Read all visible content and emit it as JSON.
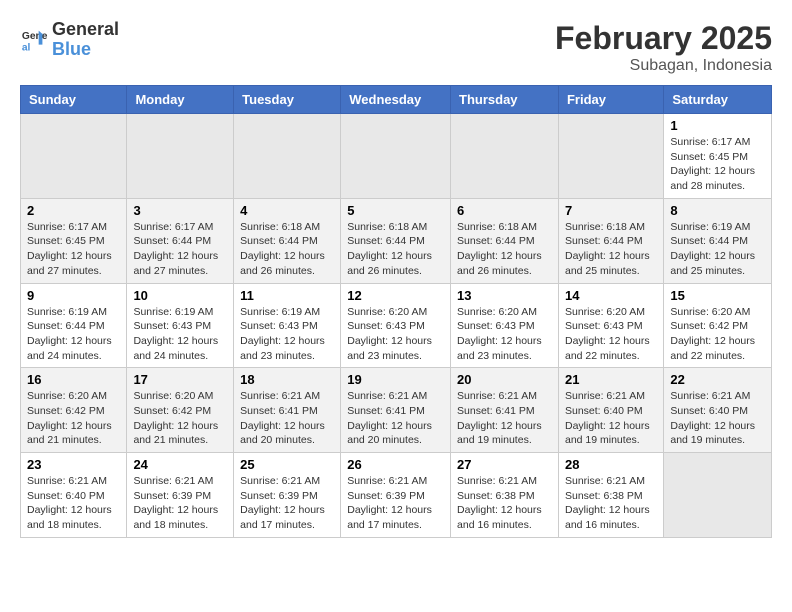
{
  "header": {
    "logo_general": "General",
    "logo_blue": "Blue",
    "month_title": "February 2025",
    "location": "Subagan, Indonesia"
  },
  "weekdays": [
    "Sunday",
    "Monday",
    "Tuesday",
    "Wednesday",
    "Thursday",
    "Friday",
    "Saturday"
  ],
  "weeks": [
    [
      {
        "day": "",
        "info": ""
      },
      {
        "day": "",
        "info": ""
      },
      {
        "day": "",
        "info": ""
      },
      {
        "day": "",
        "info": ""
      },
      {
        "day": "",
        "info": ""
      },
      {
        "day": "",
        "info": ""
      },
      {
        "day": "1",
        "info": "Sunrise: 6:17 AM\nSunset: 6:45 PM\nDaylight: 12 hours and 28 minutes."
      }
    ],
    [
      {
        "day": "2",
        "info": "Sunrise: 6:17 AM\nSunset: 6:45 PM\nDaylight: 12 hours and 27 minutes."
      },
      {
        "day": "3",
        "info": "Sunrise: 6:17 AM\nSunset: 6:44 PM\nDaylight: 12 hours and 27 minutes."
      },
      {
        "day": "4",
        "info": "Sunrise: 6:18 AM\nSunset: 6:44 PM\nDaylight: 12 hours and 26 minutes."
      },
      {
        "day": "5",
        "info": "Sunrise: 6:18 AM\nSunset: 6:44 PM\nDaylight: 12 hours and 26 minutes."
      },
      {
        "day": "6",
        "info": "Sunrise: 6:18 AM\nSunset: 6:44 PM\nDaylight: 12 hours and 26 minutes."
      },
      {
        "day": "7",
        "info": "Sunrise: 6:18 AM\nSunset: 6:44 PM\nDaylight: 12 hours and 25 minutes."
      },
      {
        "day": "8",
        "info": "Sunrise: 6:19 AM\nSunset: 6:44 PM\nDaylight: 12 hours and 25 minutes."
      }
    ],
    [
      {
        "day": "9",
        "info": "Sunrise: 6:19 AM\nSunset: 6:44 PM\nDaylight: 12 hours and 24 minutes."
      },
      {
        "day": "10",
        "info": "Sunrise: 6:19 AM\nSunset: 6:43 PM\nDaylight: 12 hours and 24 minutes."
      },
      {
        "day": "11",
        "info": "Sunrise: 6:19 AM\nSunset: 6:43 PM\nDaylight: 12 hours and 23 minutes."
      },
      {
        "day": "12",
        "info": "Sunrise: 6:20 AM\nSunset: 6:43 PM\nDaylight: 12 hours and 23 minutes."
      },
      {
        "day": "13",
        "info": "Sunrise: 6:20 AM\nSunset: 6:43 PM\nDaylight: 12 hours and 23 minutes."
      },
      {
        "day": "14",
        "info": "Sunrise: 6:20 AM\nSunset: 6:43 PM\nDaylight: 12 hours and 22 minutes."
      },
      {
        "day": "15",
        "info": "Sunrise: 6:20 AM\nSunset: 6:42 PM\nDaylight: 12 hours and 22 minutes."
      }
    ],
    [
      {
        "day": "16",
        "info": "Sunrise: 6:20 AM\nSunset: 6:42 PM\nDaylight: 12 hours and 21 minutes."
      },
      {
        "day": "17",
        "info": "Sunrise: 6:20 AM\nSunset: 6:42 PM\nDaylight: 12 hours and 21 minutes."
      },
      {
        "day": "18",
        "info": "Sunrise: 6:21 AM\nSunset: 6:41 PM\nDaylight: 12 hours and 20 minutes."
      },
      {
        "day": "19",
        "info": "Sunrise: 6:21 AM\nSunset: 6:41 PM\nDaylight: 12 hours and 20 minutes."
      },
      {
        "day": "20",
        "info": "Sunrise: 6:21 AM\nSunset: 6:41 PM\nDaylight: 12 hours and 19 minutes."
      },
      {
        "day": "21",
        "info": "Sunrise: 6:21 AM\nSunset: 6:40 PM\nDaylight: 12 hours and 19 minutes."
      },
      {
        "day": "22",
        "info": "Sunrise: 6:21 AM\nSunset: 6:40 PM\nDaylight: 12 hours and 19 minutes."
      }
    ],
    [
      {
        "day": "23",
        "info": "Sunrise: 6:21 AM\nSunset: 6:40 PM\nDaylight: 12 hours and 18 minutes."
      },
      {
        "day": "24",
        "info": "Sunrise: 6:21 AM\nSunset: 6:39 PM\nDaylight: 12 hours and 18 minutes."
      },
      {
        "day": "25",
        "info": "Sunrise: 6:21 AM\nSunset: 6:39 PM\nDaylight: 12 hours and 17 minutes."
      },
      {
        "day": "26",
        "info": "Sunrise: 6:21 AM\nSunset: 6:39 PM\nDaylight: 12 hours and 17 minutes."
      },
      {
        "day": "27",
        "info": "Sunrise: 6:21 AM\nSunset: 6:38 PM\nDaylight: 12 hours and 16 minutes."
      },
      {
        "day": "28",
        "info": "Sunrise: 6:21 AM\nSunset: 6:38 PM\nDaylight: 12 hours and 16 minutes."
      },
      {
        "day": "",
        "info": ""
      }
    ]
  ]
}
